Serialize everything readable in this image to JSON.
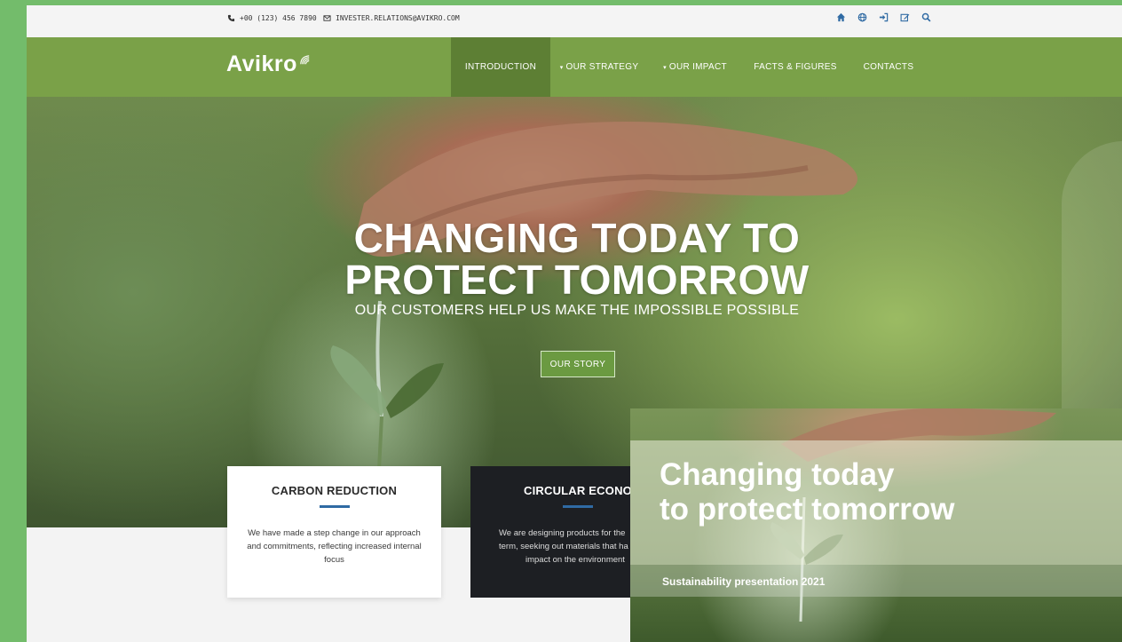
{
  "utility": {
    "phone": "+00 (123) 456 7890",
    "email": "INVESTER.RELATIONS@AVIKRO.COM",
    "icons": [
      "home-icon",
      "globe-icon",
      "sign-in-icon",
      "edit-icon",
      "search-icon"
    ]
  },
  "nav": {
    "logo": "Avikro",
    "items": [
      {
        "label": "INTRODUCTION",
        "active": true
      },
      {
        "label": "OUR STRATEGY",
        "dropdown": true
      },
      {
        "label": "OUR IMPACT",
        "dropdown": true
      },
      {
        "label": "FACTS & FIGURES"
      },
      {
        "label": "CONTACTS"
      }
    ]
  },
  "hero": {
    "title_line1": "CHANGING TODAY TO",
    "title_line2": "PROTECT TOMORROW",
    "subtitle": "OUR CUSTOMERS HELP US MAKE THE IMPOSSIBLE POSSIBLE",
    "button": "OUR STORY"
  },
  "cards": [
    {
      "title": "CARBON REDUCTION",
      "text": "We have made a step change in our approach and commitments, reflecting increased internal focus"
    },
    {
      "title": "CIRCULAR ECONOM",
      "line1": "We are designing products for the",
      "line2": "term, seeking out materials that ha",
      "line3": "impact on the environment"
    }
  ],
  "overlay": {
    "title_line1": "Changing  today",
    "title_line2": "to protect tomorrow",
    "subtitle": "Sustainability presentation 2021"
  },
  "colors": {
    "nav_green": "#7aa148",
    "nav_active": "#5d7f34",
    "accent_blue": "#2f6aa3",
    "frame_green": "#73bc6b"
  }
}
